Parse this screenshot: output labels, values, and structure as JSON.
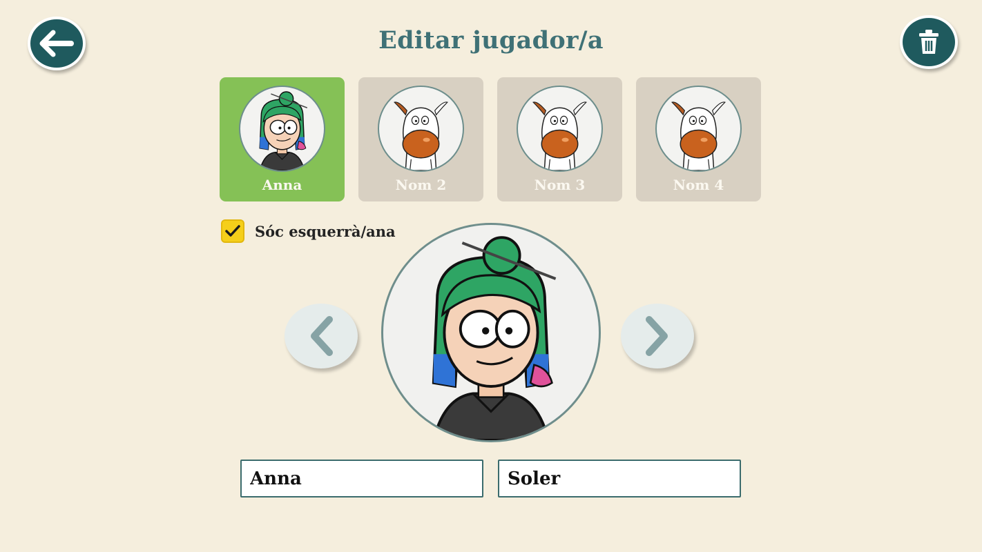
{
  "header": {
    "title": "Editar jugador/a",
    "back_icon": "arrow-left-icon",
    "delete_icon": "trash-icon"
  },
  "players": [
    {
      "name": "Anna",
      "selected": true,
      "avatar": "girl-green-hair"
    },
    {
      "name": "Nom 2",
      "selected": false,
      "avatar": "cow-placeholder"
    },
    {
      "name": "Nom 3",
      "selected": false,
      "avatar": "cow-placeholder"
    },
    {
      "name": "Nom 4",
      "selected": false,
      "avatar": "cow-placeholder"
    }
  ],
  "left_handed": {
    "label": "Sóc esquerrà/ana",
    "checked": true
  },
  "avatar_picker": {
    "prev_icon": "chevron-left-icon",
    "next_icon": "chevron-right-icon"
  },
  "form": {
    "first_name": "Anna",
    "last_name": "Soler"
  },
  "colors": {
    "background": "#f5eedd",
    "dark_teal": "#1f5a5e",
    "title_teal": "#3f7176",
    "selected_card": "#85c156",
    "card": "#d8d0c2",
    "checkbox": "#f5cf1a"
  }
}
